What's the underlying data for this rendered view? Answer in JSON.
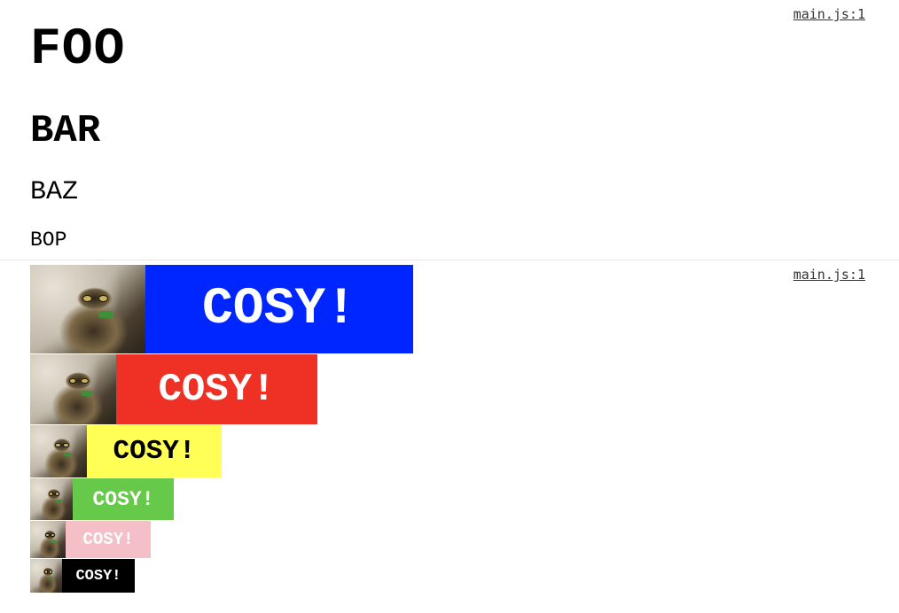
{
  "console": {
    "entries": [
      {
        "source": "main.js:1",
        "lines": [
          "FOO",
          "BAR",
          "BAZ",
          "BOP"
        ]
      },
      {
        "source": "main.js:1",
        "items": [
          {
            "text": "COSY!",
            "background": "#0026ff",
            "color": "#ffffff"
          },
          {
            "text": "COSY!",
            "background": "#ee3124",
            "color": "#ffffff"
          },
          {
            "text": "COSY!",
            "background": "#ffff55",
            "color": "#000000"
          },
          {
            "text": "COSY!",
            "background": "#66c94a",
            "color": "#ffffff"
          },
          {
            "text": "COSY!",
            "background": "#f4bfc6",
            "color": "#ffffff"
          },
          {
            "text": "COSY!",
            "background": "#000000",
            "color": "#ffffff"
          }
        ]
      }
    ]
  }
}
